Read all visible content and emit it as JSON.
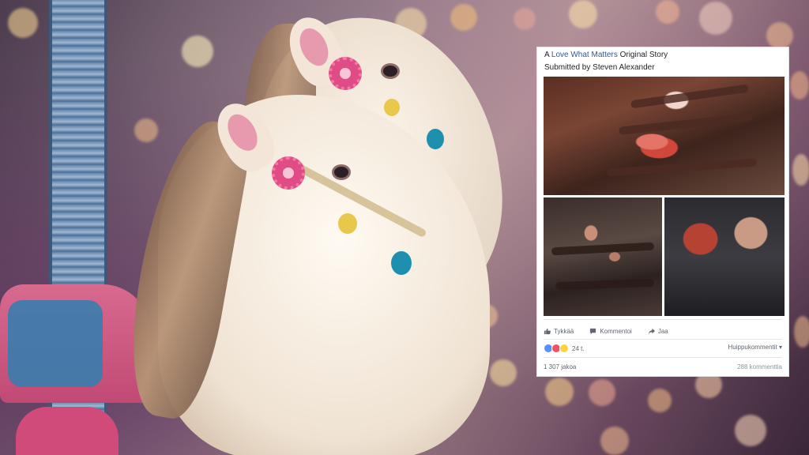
{
  "post": {
    "story_prefix": "A ",
    "story_link": "Love What Matters",
    "story_suffix": " Original Story",
    "submitted_by": "Submitted by Steven Alexander",
    "photos": [
      "photo-ride-main",
      "photo-ride-bottom-left",
      "photo-selfie-bottom-right"
    ]
  },
  "actions": {
    "like": "Tykkää",
    "comment": "Kommentoi",
    "share": "Jaa"
  },
  "stats": {
    "reaction_count": "24 t.",
    "top_comments": "Huippukommentit ▾",
    "shares": "1 307 jakoa",
    "comments": "288 kommenttia"
  },
  "colors": {
    "link": "#365899",
    "like_reaction": "#5890ff",
    "love_reaction": "#f25268",
    "haha_reaction": "#fcd440"
  },
  "icons": [
    "like-icon",
    "comment-icon",
    "share-icon"
  ]
}
